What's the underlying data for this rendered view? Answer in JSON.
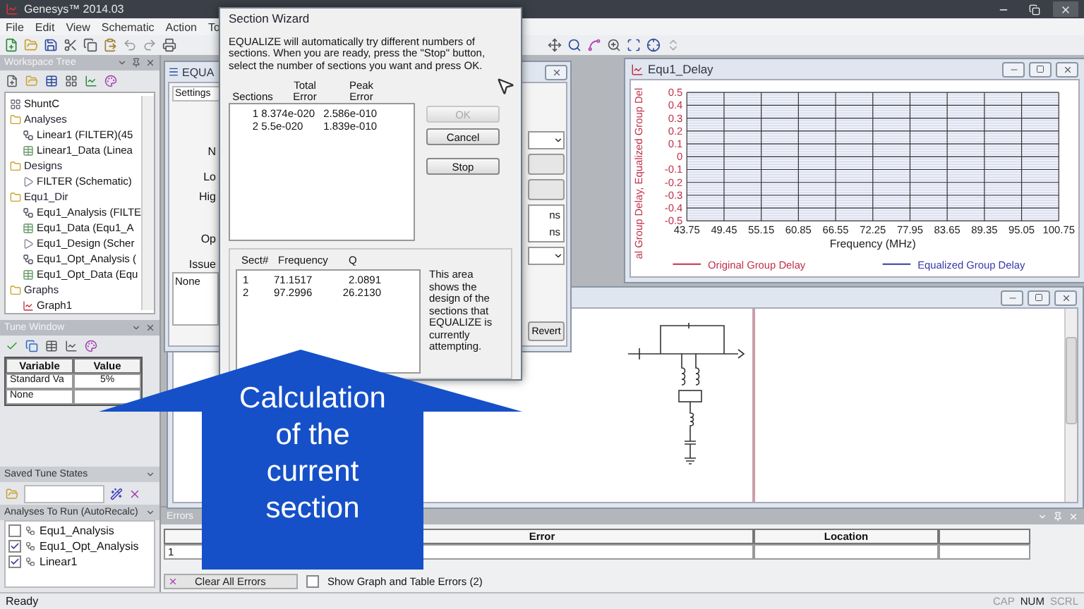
{
  "window": {
    "title": "Genesys™ 2014.03"
  },
  "menu": [
    "File",
    "Edit",
    "View",
    "Schematic",
    "Action",
    "To"
  ],
  "workspace_tree": {
    "title": "Workspace Tree",
    "items": [
      {
        "label": "ShuntC",
        "kind": "schematic"
      },
      {
        "label": "Analyses",
        "kind": "folder",
        "children": [
          {
            "label": "Linear1 (FILTER)(45",
            "kind": "analysis"
          },
          {
            "label": "Linear1_Data (Linea",
            "kind": "data"
          }
        ]
      },
      {
        "label": "Designs",
        "kind": "folder",
        "children": [
          {
            "label": "FILTER (Schematic)",
            "kind": "design"
          }
        ]
      },
      {
        "label": "Equ1_Dir",
        "kind": "folder",
        "children": [
          {
            "label": "Equ1_Analysis (FILTE",
            "kind": "analysis"
          },
          {
            "label": "Equ1_Data (Equ1_A",
            "kind": "data"
          },
          {
            "label": "Equ1_Design (Scher",
            "kind": "design"
          },
          {
            "label": "Equ1_Opt_Analysis (",
            "kind": "analysis"
          },
          {
            "label": "Equ1_Opt_Data (Equ",
            "kind": "data"
          }
        ]
      },
      {
        "label": "Graphs",
        "kind": "folder",
        "children": [
          {
            "label": "Graph1",
            "kind": "graph"
          }
        ]
      }
    ]
  },
  "tune_window": {
    "title": "Tune Window",
    "columns": [
      "Variable",
      "Value"
    ],
    "rows": [
      {
        "variable": "Standard Va",
        "value": "5%"
      },
      {
        "variable": "None"
      }
    ]
  },
  "saved_tune_states": {
    "title": "Saved Tune States"
  },
  "analyses_to_run": {
    "title": "Analyses To Run (AutoRecalc)",
    "items": [
      {
        "label": "Equ1_Analysis",
        "checked": false
      },
      {
        "label": "Equ1_Opt_Analysis",
        "checked": true
      },
      {
        "label": "Linear1",
        "checked": true
      }
    ]
  },
  "equalize_window": {
    "title": "EQUA",
    "tab": "Settings",
    "labels": [
      "N",
      "Lo",
      "Hig",
      "Op",
      "Issue"
    ],
    "issues": "None",
    "units": [
      "ns",
      "ns"
    ],
    "button": "Revert"
  },
  "graph_window": {
    "title": "Equ1_Delay",
    "chart_data": {
      "type": "line",
      "xlabel": "Frequency (MHz)",
      "ylabel": "al Group Delay, Equalized Group Del",
      "grid": true,
      "categories": [
        "43.75",
        "49.45",
        "55.15",
        "60.85",
        "66.55",
        "72.25",
        "77.95",
        "83.65",
        "89.35",
        "95.05",
        "100.75"
      ],
      "yticks": [
        -0.5,
        -0.4,
        -0.3,
        -0.2,
        -0.1,
        0,
        0.1,
        0.2,
        0.3,
        0.4,
        0.5
      ],
      "ylim": [
        -0.5,
        0.5
      ],
      "series": [
        {
          "name": "Original Group Delay",
          "color": "#c0304a",
          "values": [
            null,
            null,
            null,
            null,
            null,
            null,
            null,
            null,
            null,
            null,
            null
          ]
        },
        {
          "name": "Equalized Group Delay",
          "color": "#3838a8",
          "values": [
            null,
            null,
            null,
            null,
            null,
            null,
            null,
            null,
            null,
            null,
            null
          ]
        }
      ]
    }
  },
  "section_wizard": {
    "title": "Section Wizard",
    "description": "EQUALIZE will automatically try different numbers of sections.  When you are ready, press the \"Stop\" button, select the number of sections you want and press OK.",
    "sections_columns": [
      "Sections",
      "Total\nError",
      "Peak\nError"
    ],
    "sections_rows": [
      [
        "1",
        "8.374e-020",
        "2.586e-010"
      ],
      [
        "2",
        "5.5e-020",
        "1.839e-010"
      ]
    ],
    "buttons": [
      {
        "label": "OK",
        "disabled": true
      },
      {
        "label": "Cancel",
        "disabled": false
      },
      {
        "label": "Stop",
        "disabled": false
      }
    ],
    "design_columns": [
      "Sect#",
      "Frequency",
      "Q"
    ],
    "design_rows": [
      [
        "1",
        "71.1517",
        "2.0891"
      ],
      [
        "2",
        "97.2996",
        "26.2130"
      ]
    ],
    "note": "This area shows the design of the sections that EQUALIZE is currently attempting."
  },
  "callout": {
    "text": "Calculation\nof the\ncurrent\nsection"
  },
  "errors": {
    "title": "Errors",
    "columns": [
      "Error",
      "Location"
    ],
    "rows": [
      {
        "number": "1"
      }
    ],
    "clear_button": "Clear All Errors",
    "show_option": {
      "label": "Show Graph and Table Errors (2)",
      "checked": false
    }
  },
  "status_bar": {
    "message": "Ready",
    "indicators": [
      {
        "label": "CAP",
        "on": false
      },
      {
        "label": "NUM",
        "on": true
      },
      {
        "label": "SCRL",
        "on": false
      }
    ]
  }
}
